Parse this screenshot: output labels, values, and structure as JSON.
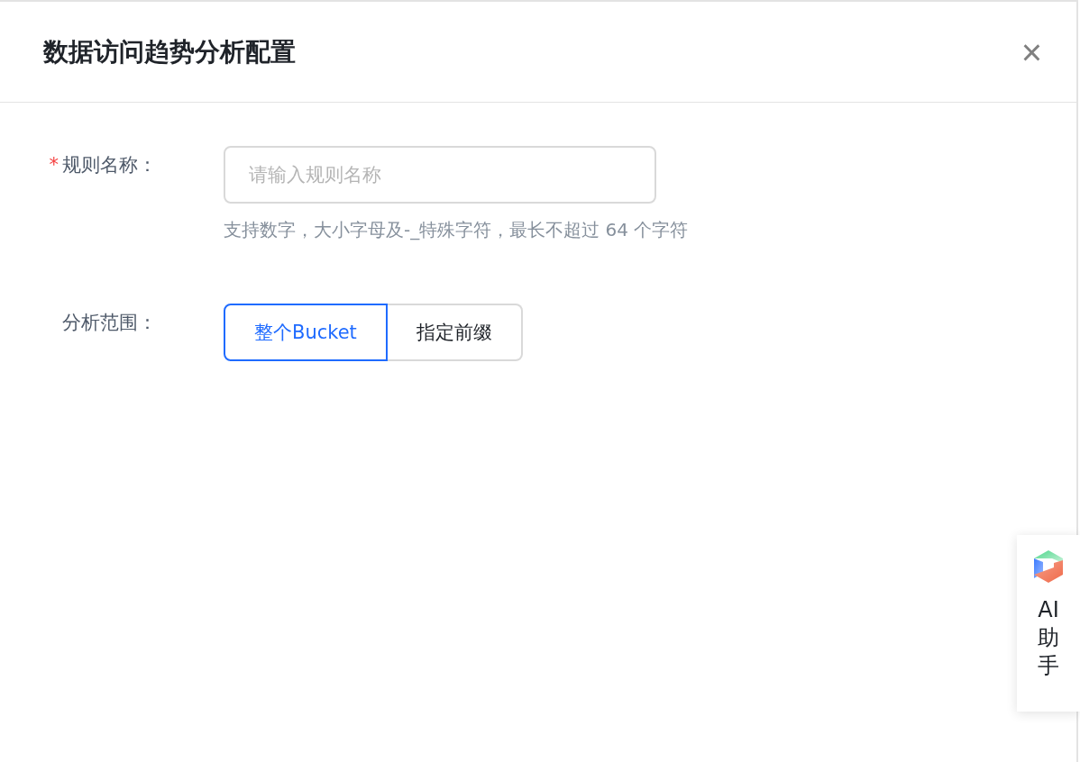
{
  "dialog": {
    "title": "数据访问趋势分析配置",
    "close": "×"
  },
  "form": {
    "fields": [
      {
        "kind": "input",
        "required_mark": "*",
        "label": "规则名称：",
        "placeholder": "请输入规则名称",
        "help": "支持数字，大小字母及-_特殊字符，最长不超过 64 个字符"
      },
      {
        "kind": "segmented",
        "label": "分析范围：",
        "options": [
          {
            "label": "整个Bucket",
            "selected": true
          },
          {
            "label": "指定前缀",
            "selected": false
          }
        ]
      }
    ]
  },
  "assistant": {
    "label": "AI助手"
  }
}
